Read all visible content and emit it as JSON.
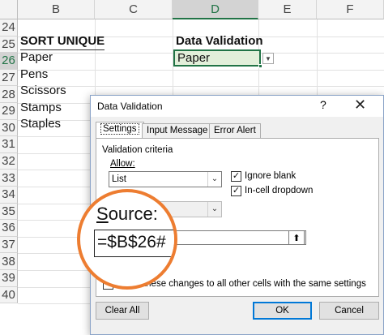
{
  "sheet": {
    "columns": [
      {
        "id": "col-b",
        "label": "B",
        "selected": false
      },
      {
        "id": "col-c",
        "label": "C",
        "selected": false
      },
      {
        "id": "col-d",
        "label": "D",
        "selected": true
      },
      {
        "id": "col-e",
        "label": "E",
        "selected": false
      },
      {
        "id": "col-f",
        "label": "F",
        "selected": false
      }
    ],
    "rows": [
      "24",
      "25",
      "26",
      "27",
      "28",
      "29",
      "30",
      "31",
      "32",
      "33",
      "34",
      "35",
      "36",
      "37",
      "38",
      "39",
      "40"
    ],
    "selected_row": "26",
    "sort_header": "SORT UNIQUE",
    "items": [
      "Paper",
      "Pens",
      "Scissors",
      "Stamps",
      "Staples"
    ],
    "dv_header": "Data Validation",
    "active_cell_value": "Paper",
    "accent_color": "#217346"
  },
  "dialog": {
    "title": "Data Validation",
    "help_label": "?",
    "close_label": "✕",
    "tabs": [
      "Settings",
      "Input Message",
      "Error Alert"
    ],
    "active_tab": "Settings",
    "criteria_heading": "Validation criteria",
    "allow_label": "Allow:",
    "allow_value": "List",
    "ignore_blank_label": "Ignore blank",
    "ignore_blank_checked": true,
    "in_cell_dropdown_label": "In-cell dropdown",
    "in_cell_dropdown_checked": true,
    "apply_label": "Apply these changes to all other cells with the same settings",
    "clear_all_label": "Clear All",
    "ok_label": "OK",
    "cancel_label": "Cancel"
  },
  "callout": {
    "label": "Source:",
    "value": "=$B$26#",
    "border_color": "#ed7d31"
  }
}
